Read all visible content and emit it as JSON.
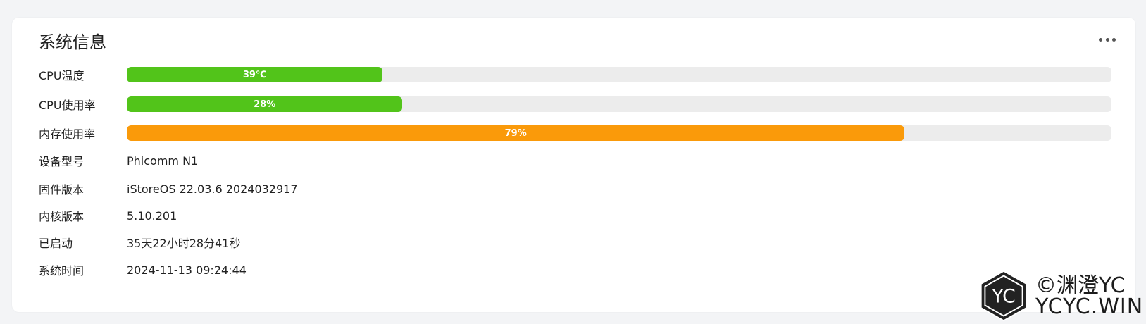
{
  "card": {
    "title": "系统信息",
    "more_icon": "more-horizontal-icon"
  },
  "bars": [
    {
      "label": "CPU温度",
      "text": "39℃",
      "percent": 26,
      "color": "#52c41a"
    },
    {
      "label": "CPU使用率",
      "text": "28%",
      "percent": 28,
      "color": "#52c41a"
    },
    {
      "label": "内存使用率",
      "text": "79%",
      "percent": 79,
      "color": "#fa9a0a"
    }
  ],
  "info": [
    {
      "label": "设备型号",
      "value": "Phicomm N1"
    },
    {
      "label": "固件版本",
      "value": "iStoreOS 22.03.6 2024032917"
    },
    {
      "label": "内核版本",
      "value": "5.10.201"
    },
    {
      "label": "已启动",
      "value": "35天22小时28分41秒"
    },
    {
      "label": "系统时间",
      "value": "2024-11-13 09:24:44"
    }
  ],
  "watermark": {
    "logo_text": "YC",
    "line1": "©渊澄YC",
    "line2": "YCYC.WIN"
  }
}
